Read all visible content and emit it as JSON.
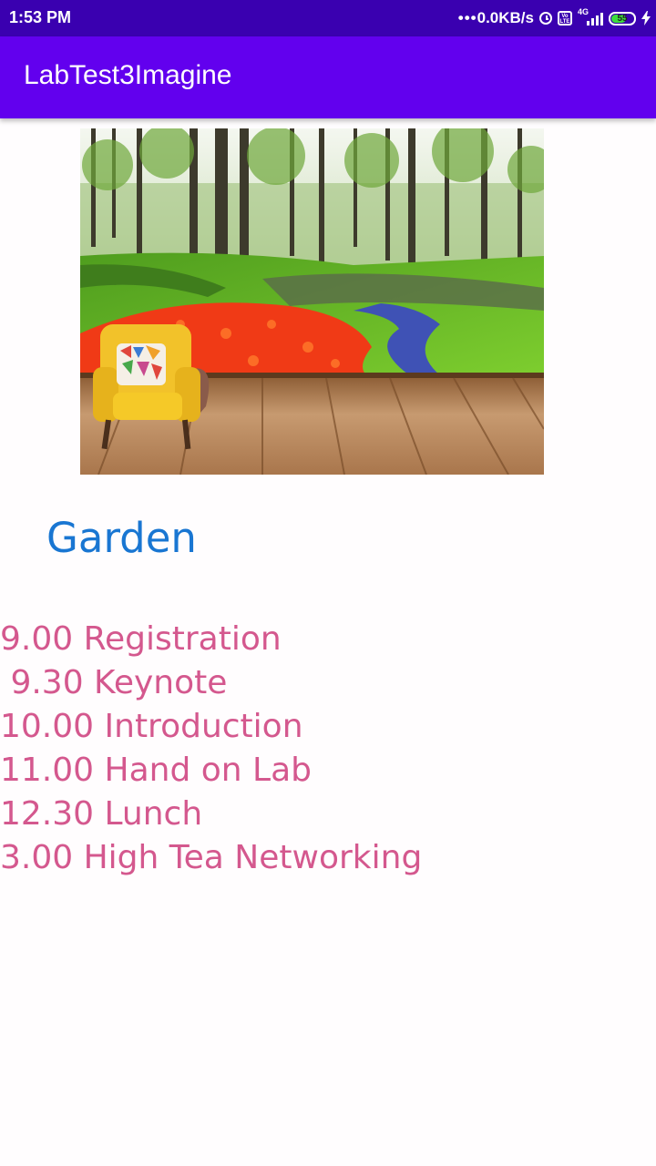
{
  "status_bar": {
    "time": "1:53 PM",
    "net_speed": "0.0KB/s",
    "network_type": "4G",
    "battery_level": "55",
    "icons": [
      "alarm-icon",
      "volte-icon",
      "signal-icon",
      "battery-icon",
      "charging-icon"
    ]
  },
  "app_bar": {
    "title": "LabTest3Imagine",
    "color": "#6200ee"
  },
  "hero_image": {
    "icon": "garden-image"
  },
  "content": {
    "heading": "Garden",
    "heading_color": "#1976d2",
    "text_color": "#d4588e",
    "schedule": [
      "9.00 Registration",
      " 9.30 Keynote",
      "10.00 Introduction",
      "11.00 Hand on Lab",
      "12.30 Lunch",
      "3.00 High Tea Networking"
    ]
  }
}
